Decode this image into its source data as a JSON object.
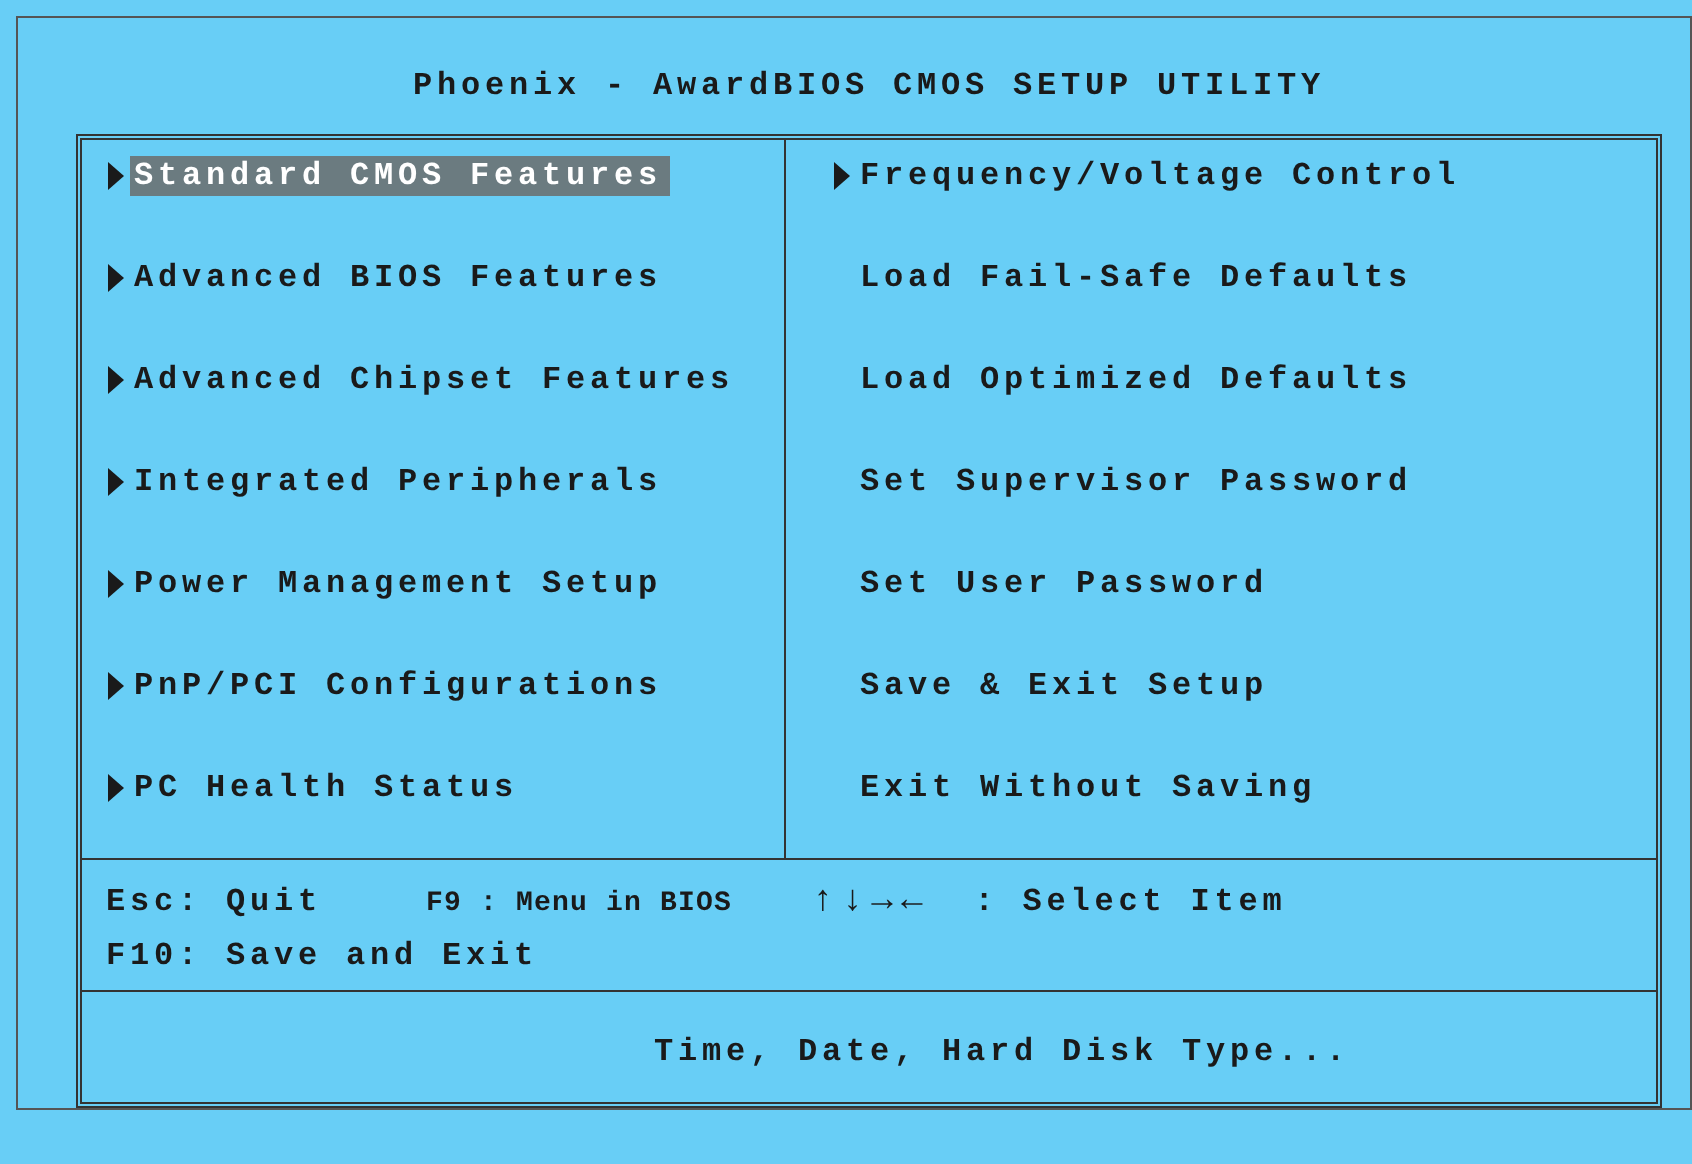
{
  "title": "Phoenix - AwardBIOS CMOS SETUP UTILITY",
  "menu_left": [
    {
      "label": "Standard CMOS Features",
      "kind": "submenu",
      "selected": true
    },
    {
      "label": "Advanced BIOS Features",
      "kind": "submenu",
      "selected": false
    },
    {
      "label": "Advanced Chipset Features",
      "kind": "submenu",
      "selected": false
    },
    {
      "label": "Integrated Peripherals",
      "kind": "submenu",
      "selected": false
    },
    {
      "label": "Power Management Setup",
      "kind": "submenu",
      "selected": false
    },
    {
      "label": "PnP/PCI Configurations",
      "kind": "submenu",
      "selected": false
    },
    {
      "label": "PC Health Status",
      "kind": "submenu",
      "selected": false
    }
  ],
  "menu_right": [
    {
      "label": "Frequency/Voltage Control",
      "kind": "submenu",
      "selected": false
    },
    {
      "label": "Load Fail-Safe Defaults",
      "kind": "action",
      "selected": false
    },
    {
      "label": "Load Optimized Defaults",
      "kind": "action",
      "selected": false
    },
    {
      "label": "Set Supervisor Password",
      "kind": "action",
      "selected": false
    },
    {
      "label": "Set User Password",
      "kind": "action",
      "selected": false
    },
    {
      "label": "Save & Exit Setup",
      "kind": "action",
      "selected": false
    },
    {
      "label": "Exit Without Saving",
      "kind": "action",
      "selected": false
    }
  ],
  "key_help": {
    "esc": "Esc: Quit",
    "f9": "F9 : Menu in BIOS",
    "arrows": "↑↓→←",
    "select": ": Select Item",
    "f10": "F10: Save and Exit"
  },
  "help_text": "Time, Date, Hard Disk Type..."
}
